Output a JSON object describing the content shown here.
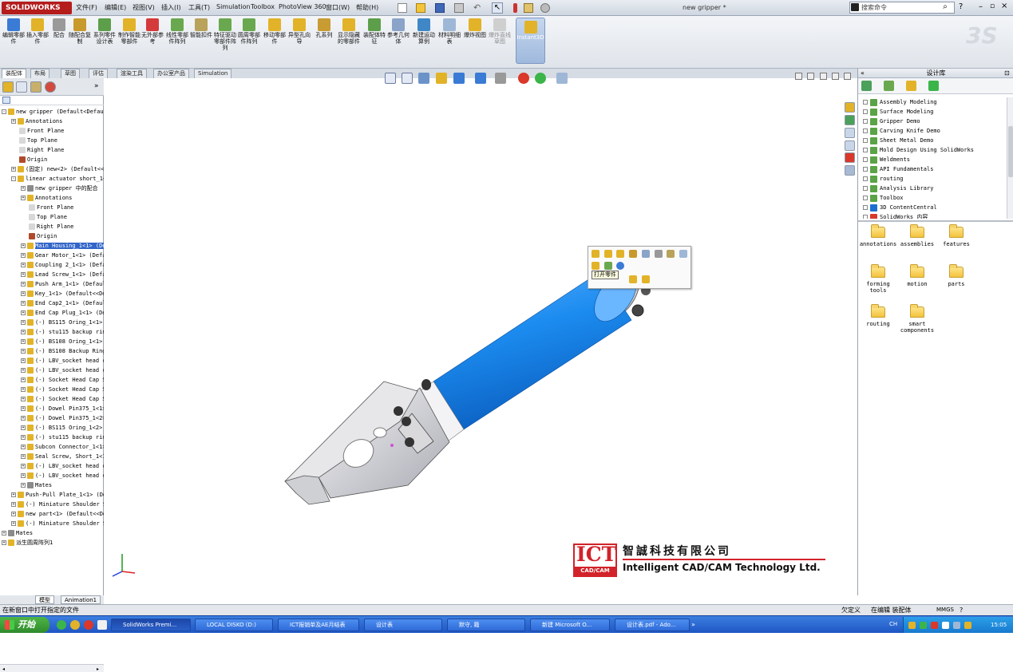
{
  "app": {
    "logo": "SOLIDWORKS",
    "document_title": "new gripper *"
  },
  "menu": [
    "文件(F)",
    "编辑(E)",
    "视图(V)",
    "插入(I)",
    "工具(T)",
    "Simulation",
    "Toolbox",
    "PhotoView 360",
    "窗口(W)",
    "帮助(H)"
  ],
  "search": {
    "placeholder": "搜索命令"
  },
  "ribbon": {
    "buttons": [
      "编辑零部件",
      "插入零部件",
      "配合",
      "随配合复制",
      "系列零件设计表",
      "制作智能零部件",
      "无外部参考",
      "线性零部件阵列",
      "智能扣件",
      "特征驱动零部件阵列",
      "圆周零部件阵列",
      "移动零部件",
      "异型孔向导",
      "孔系列",
      "显示隐藏的零部件",
      "装配体特征",
      "参考几何体",
      "新建运动算例",
      "材料明细表",
      "爆炸视图",
      "爆炸直线草图",
      "Instant3D"
    ]
  },
  "command_tabs": [
    "装配体",
    "布局",
    "草图",
    "评估",
    "渲染工具",
    "办公室产品",
    "Simulation"
  ],
  "tree": {
    "rows": [
      {
        "indent": 0,
        "exp": "-",
        "label": "new gripper  (Default<Default"
      },
      {
        "indent": 1,
        "exp": "+",
        "label": "Annotations"
      },
      {
        "indent": 1,
        "exp": "",
        "label": "Front Plane"
      },
      {
        "indent": 1,
        "exp": "",
        "label": "Top Plane"
      },
      {
        "indent": 1,
        "exp": "",
        "label": "Right Plane"
      },
      {
        "indent": 1,
        "exp": "",
        "label": "Origin"
      },
      {
        "indent": 1,
        "exp": "+",
        "label": "(固定) new<2> (Default<<D"
      },
      {
        "indent": 1,
        "exp": "-",
        "label": "linear actuator short_1<1"
      },
      {
        "indent": 2,
        "exp": "+",
        "label": "new gripper 中的配合"
      },
      {
        "indent": 2,
        "exp": "+",
        "label": "Annotations"
      },
      {
        "indent": 2,
        "exp": "",
        "label": "Front Plane"
      },
      {
        "indent": 2,
        "exp": "",
        "label": "Top Plane"
      },
      {
        "indent": 2,
        "exp": "",
        "label": "Right Plane"
      },
      {
        "indent": 2,
        "exp": "",
        "label": "Origin"
      },
      {
        "indent": 2,
        "exp": "+",
        "label": "Main Housing_1<1> (Def",
        "selected": true
      },
      {
        "indent": 2,
        "exp": "+",
        "label": "Gear Motor_1<1> (Defau"
      },
      {
        "indent": 2,
        "exp": "+",
        "label": "Coupling 2_1<1> (Defau"
      },
      {
        "indent": 2,
        "exp": "+",
        "label": "Lead Screw_1<1> (Defau"
      },
      {
        "indent": 2,
        "exp": "+",
        "label": "Push Arm_1<1> (Default"
      },
      {
        "indent": 2,
        "exp": "+",
        "label": "Key_1<1> (Default<<Def"
      },
      {
        "indent": 2,
        "exp": "+",
        "label": "End Cap2_1<1> (Default"
      },
      {
        "indent": 2,
        "exp": "+",
        "label": "End Cap Plug_1<1> (Def"
      },
      {
        "indent": 2,
        "exp": "+",
        "label": "(-) BS115 Oring_1<1> ("
      },
      {
        "indent": 2,
        "exp": "+",
        "label": "(-) stu115 backup ring"
      },
      {
        "indent": 2,
        "exp": "+",
        "label": "(-) BS108 Oring_1<1> ("
      },
      {
        "indent": 2,
        "exp": "+",
        "label": "(-) BS108 Backup Ring_"
      },
      {
        "indent": 2,
        "exp": "+",
        "label": "(-) LBV_socket head ca"
      },
      {
        "indent": 2,
        "exp": "+",
        "label": "(-) LBV_socket head ca"
      },
      {
        "indent": 2,
        "exp": "+",
        "label": "(-) Socket Head Cap Sc"
      },
      {
        "indent": 2,
        "exp": "+",
        "label": "(-) Socket Head Cap Sc"
      },
      {
        "indent": 2,
        "exp": "+",
        "label": "(-) Socket Head Cap Sc"
      },
      {
        "indent": 2,
        "exp": "+",
        "label": "(-) Dowel Pin375_1<1>"
      },
      {
        "indent": 2,
        "exp": "+",
        "label": "(-) Dowel Pin375_1<2>"
      },
      {
        "indent": 2,
        "exp": "+",
        "label": "(-) BS115 Oring_1<2> ("
      },
      {
        "indent": 2,
        "exp": "+",
        "label": "(-) stu115 backup ring"
      },
      {
        "indent": 2,
        "exp": "+",
        "label": "Subcon Connector_1<1>"
      },
      {
        "indent": 2,
        "exp": "+",
        "label": "Seal Screw, Short_1<1>"
      },
      {
        "indent": 2,
        "exp": "+",
        "label": "(-) LBV_socket head ca"
      },
      {
        "indent": 2,
        "exp": "+",
        "label": "(-) LBV_socket head ca"
      },
      {
        "indent": 2,
        "exp": "+",
        "label": "Mates"
      },
      {
        "indent": 1,
        "exp": "+",
        "label": "Push-Pull Plate_1<1> (Def"
      },
      {
        "indent": 1,
        "exp": "+",
        "label": "(-) Miniature Shoulder Sc"
      },
      {
        "indent": 1,
        "exp": "+",
        "label": "new part<1> (Default<<Def"
      },
      {
        "indent": 1,
        "exp": "+",
        "label": "(-) Miniature Shoulder Sc"
      },
      {
        "indent": 0,
        "exp": "+",
        "label": "Mates"
      },
      {
        "indent": 0,
        "exp": "+",
        "label": "派生圆周阵列1"
      }
    ]
  },
  "bottom_tabs": [
    "模型",
    "Animation1"
  ],
  "context_tooltip": "打开零件",
  "task_pane": {
    "title": "设计库",
    "libraries": [
      "Assembly Modeling",
      "Surface Modeling",
      "Gripper Demo",
      "Carving Knife Demo",
      "Sheet Metal Demo",
      "Mold Design Using SolidWorks",
      "Weldments",
      "API Fundamentals",
      "routing",
      "Analysis Library",
      "Toolbox",
      "3D ContentCentral",
      "SolidWorks 内容"
    ],
    "folders": [
      "annotations",
      "assemblies",
      "features",
      "forming tools",
      "motion",
      "parts",
      "routing",
      "smart components"
    ]
  },
  "branding": {
    "ict": "ICT",
    "ict_sub": "CAD/CAM",
    "company_cn": "智誠科技有限公司",
    "company_en": "Intelligent CAD/CAM Technology Ltd."
  },
  "status_bar": {
    "message": "在新窗口中打开指定的文件",
    "status1": "欠定义",
    "status2": "在编辑 装配体",
    "units": "MMGS"
  },
  "taskbar": {
    "start": "开始",
    "tasks": [
      "SolidWorks Premi...",
      "LOCAL DISKO (D:)",
      "ICT报销单及AE月结表",
      "设计表",
      "默守, 籍",
      "新建 Microsoft O...",
      "设计表.pdf - Ado..."
    ],
    "lang": "CH",
    "clock": "15:05"
  }
}
